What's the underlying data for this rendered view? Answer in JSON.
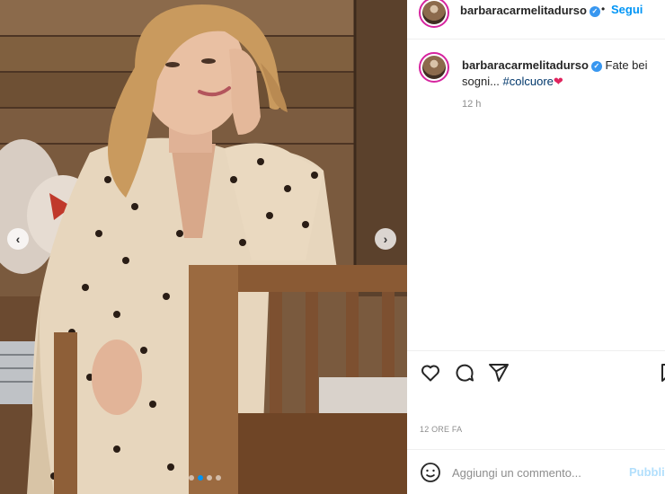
{
  "post": {
    "username": "barbaracarmelitadurso",
    "verified_icon": "verified-badge-icon",
    "follow_label": "Segui",
    "separator": "•",
    "caption_text": "Fate bei sogni... ",
    "caption_hashtag": "#colcuore",
    "caption_emoji": "❤",
    "caption_time": "12 h",
    "post_time": "12 ORE FA",
    "carousel": {
      "prev_icon": "chevron-left-icon",
      "next_icon": "chevron-right-icon",
      "prev_glyph": "‹",
      "next_glyph": "›",
      "slide_count": 4,
      "active_slide": 2
    },
    "actions": [
      "heart-icon",
      "comment-icon",
      "share-icon",
      "bookmark-icon"
    ],
    "comment": {
      "placeholder": "Aggiungi un commento...",
      "publish_label": "Pubblica"
    }
  },
  "colors": {
    "link_blue": "#0095f6",
    "hashtag": "#00376b",
    "muted": "#8e8e8e",
    "publish_disabled": "#b2dffc"
  }
}
